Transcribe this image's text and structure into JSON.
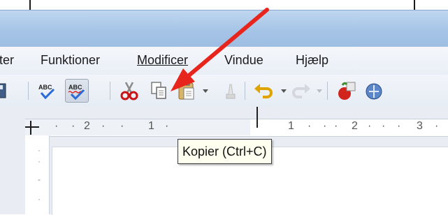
{
  "menubar": {
    "items": [
      {
        "label": "ter"
      },
      {
        "label": "Funktioner"
      },
      {
        "label": "Modificer"
      },
      {
        "label": "Vindue"
      },
      {
        "label": "Hjælp"
      }
    ]
  },
  "toolbar": {
    "buttons": [
      {
        "icon": "save-icon"
      },
      {
        "icon": "spellcheck-icon"
      },
      {
        "icon": "autospellcheck-icon"
      },
      {
        "icon": "cut-icon"
      },
      {
        "icon": "copy-icon"
      },
      {
        "icon": "paste-icon"
      },
      {
        "icon": "clone-formatting-icon"
      },
      {
        "icon": "undo-icon"
      },
      {
        "icon": "redo-icon"
      },
      {
        "icon": "insert-object-icon"
      }
    ],
    "spell_label": "ABC"
  },
  "ruler": {
    "ticks": [
      "2",
      "1",
      "1",
      "2",
      "3"
    ]
  },
  "tooltip": {
    "text": "Kopier (Ctrl+C)"
  },
  "colors": {
    "annotation_arrow": "#e8251c",
    "titlebar": "#a6c4e6"
  }
}
